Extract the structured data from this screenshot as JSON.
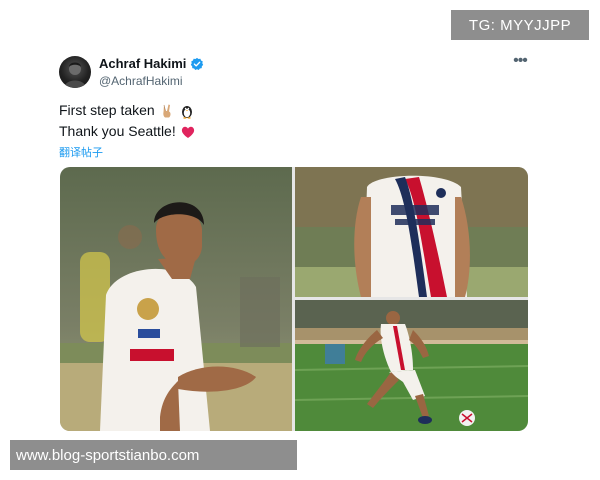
{
  "tweet": {
    "display_name": "Achraf Hakimi",
    "verified_icon": "verified-badge-icon",
    "handle": "@AchrafHakimi",
    "lines": [
      {
        "text": "First step taken",
        "emojis": [
          "victory-hand-icon",
          "penguin-icon"
        ]
      },
      {
        "text": "Thank you Seattle!",
        "emojis": [
          "red-heart-icon"
        ]
      }
    ],
    "translate_label": "翻译帖子",
    "more_icon": "more-options-icon",
    "media": [
      {
        "name": "photo-player-clapping"
      },
      {
        "name": "photo-jersey-closeup"
      },
      {
        "name": "photo-player-kicking-ball"
      }
    ]
  },
  "watermarks": {
    "telegram": "TG: MYYJJPP",
    "site": "www.blog-sportstianbo.com"
  },
  "colors": {
    "link_blue": "#1d9bf0",
    "verified_blue": "#1d9bf0",
    "secondary_text": "#536471",
    "watermark_bg": "#8e8e8e"
  }
}
